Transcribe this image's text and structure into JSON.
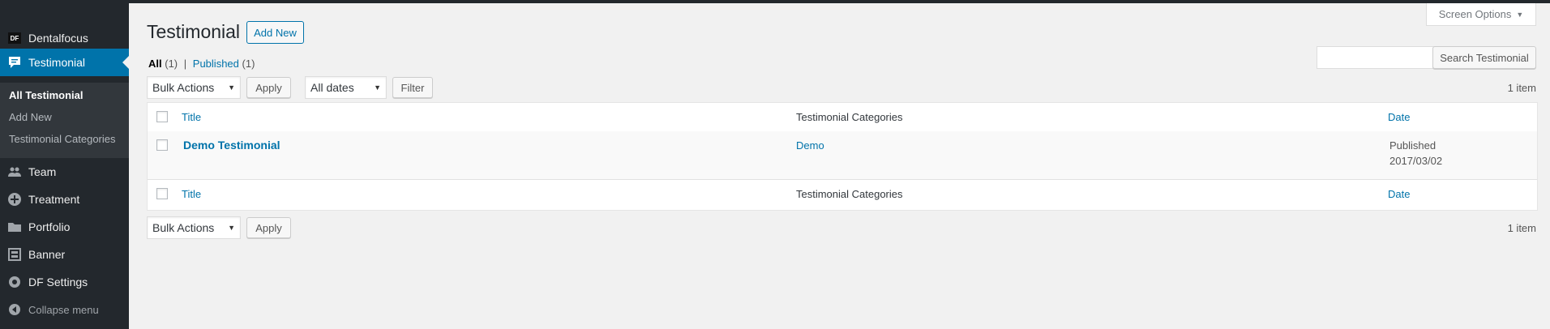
{
  "sidebar": {
    "items": [
      {
        "label": "Dentalfocus",
        "icon": "df-logo-icon"
      },
      {
        "label": "Testimonial",
        "icon": "testimonial-icon"
      },
      {
        "label": "Team",
        "icon": "team-icon"
      },
      {
        "label": "Treatment",
        "icon": "plus-circle-icon"
      },
      {
        "label": "Portfolio",
        "icon": "folder-icon"
      },
      {
        "label": "Banner",
        "icon": "banner-icon"
      },
      {
        "label": "DF Settings",
        "icon": "settings-icon"
      }
    ],
    "df_badge": "DF",
    "submenu": [
      "All Testimonial",
      "Add New",
      "Testimonial Categories"
    ],
    "collapse_label": "Collapse menu"
  },
  "header": {
    "title": "Testimonial",
    "add_new_label": "Add New",
    "screen_options_label": "Screen Options"
  },
  "views": {
    "all_label": "All",
    "all_count": "(1)",
    "separator": "|",
    "published_label": "Published",
    "published_count": "(1)"
  },
  "toolbar": {
    "bulk_actions": "Bulk Actions",
    "apply_label": "Apply",
    "dates": "All dates",
    "filter_label": "Filter",
    "search_button": "Search Testimonial",
    "item_count": "1 item"
  },
  "table": {
    "columns": [
      "Title",
      "Testimonial Categories",
      "Date"
    ],
    "rows": [
      {
        "title": "Demo Testimonial",
        "category": "Demo",
        "status": "Published",
        "date": "2017/03/02"
      }
    ]
  },
  "colors": {
    "accent": "#0073aa",
    "sidebar_bg": "#23282d",
    "submenu_bg": "#32373c",
    "page_bg": "#f1f1f1"
  }
}
